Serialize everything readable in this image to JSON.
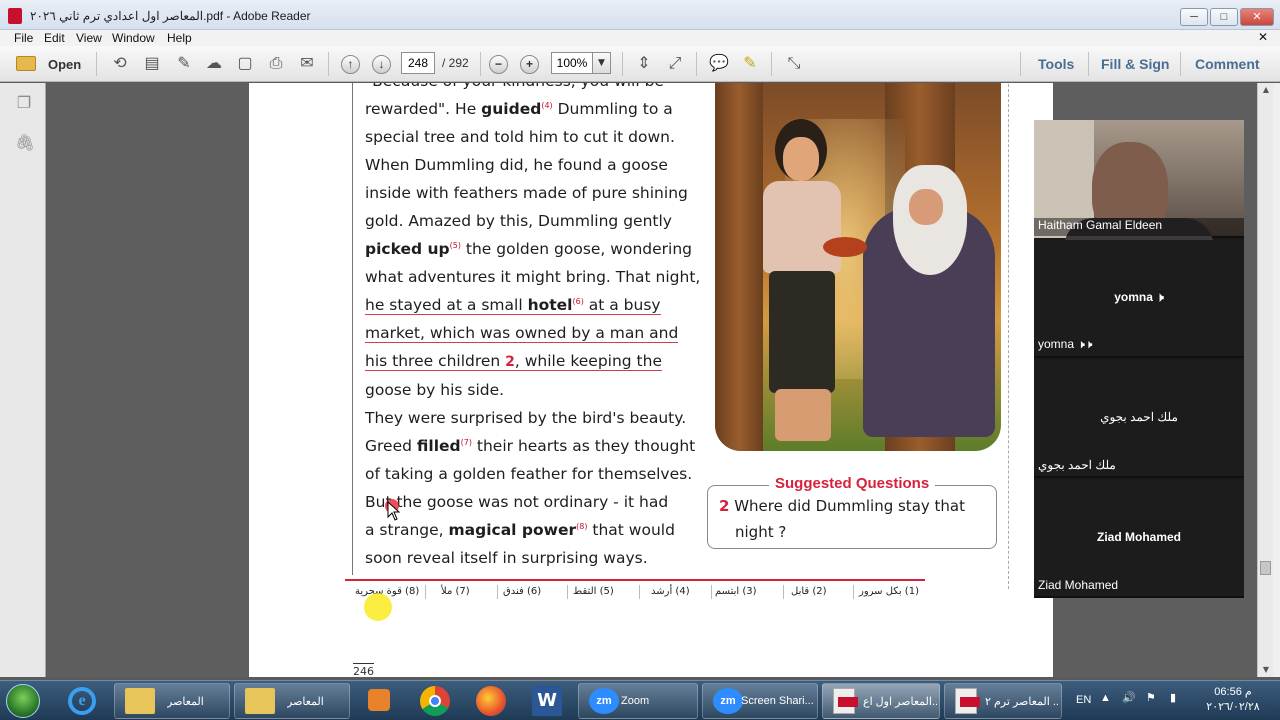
{
  "window": {
    "title": "المعاصر اول اعدادي ترم ثاني ٢٠٢٦.pdf - Adobe Reader",
    "minimize": "─",
    "maximize": "□",
    "close": "✕"
  },
  "menu": {
    "items": [
      "File",
      "Edit",
      "View",
      "Window",
      "Help"
    ],
    "doc_close": "✕"
  },
  "toolbar": {
    "open_label": "Open",
    "page_current": "248",
    "page_total": "/ 292",
    "zoom": "100%",
    "right_tools": [
      "Tools",
      "Fill & Sign",
      "Comment"
    ]
  },
  "story": {
    "lines": [
      {
        "parts": [
          {
            "t": "\"Because of your kindness, you will be"
          }
        ]
      },
      {
        "parts": [
          {
            "t": "rewarded\". He "
          },
          {
            "t": "guided",
            "b": true
          },
          {
            "t": "(4)",
            "sup": true
          },
          {
            "t": " Dummling to a"
          }
        ]
      },
      {
        "parts": [
          {
            "t": "special tree and told him to cut it down."
          }
        ]
      },
      {
        "parts": [
          {
            "t": "When Dummling did, he found a goose"
          }
        ]
      },
      {
        "parts": [
          {
            "t": "inside with feathers made of pure shining"
          }
        ]
      },
      {
        "parts": [
          {
            "t": "gold. Amazed by this, Dummling gently"
          }
        ]
      },
      {
        "parts": [
          {
            "t": "picked up",
            "b": true
          },
          {
            "t": "(5)",
            "sup": true
          },
          {
            "t": " the golden goose, wondering"
          }
        ]
      },
      {
        "parts": [
          {
            "t": "what adventures it might bring. That night,"
          }
        ]
      },
      {
        "hl": true,
        "parts": [
          {
            "t": "he stayed at a small "
          },
          {
            "t": "hotel",
            "b": true
          },
          {
            "t": "(6)",
            "sup": true
          },
          {
            "t": " at a busy"
          }
        ]
      },
      {
        "hl": true,
        "parts": [
          {
            "t": "market, which was owned by a man and"
          }
        ]
      },
      {
        "hl": true,
        "parts": [
          {
            "t": "his three children"
          },
          {
            "t": " 2",
            "q": true
          },
          {
            "t": ", while keeping the"
          }
        ]
      },
      {
        "parts": [
          {
            "t": "goose by his side."
          }
        ]
      },
      {
        "parts": [
          {
            "t": "They were surprised by the bird's beauty."
          }
        ]
      },
      {
        "parts": [
          {
            "t": "Greed "
          },
          {
            "t": "filled",
            "b": true
          },
          {
            "t": "(7)",
            "sup": true
          },
          {
            "t": " their hearts as they thought"
          }
        ]
      },
      {
        "parts": [
          {
            "t": "of taking a golden feather for themselves."
          }
        ]
      },
      {
        "parts": [
          {
            "t": "But the goose was not ordinary - it had"
          }
        ]
      },
      {
        "parts": [
          {
            "t": "a strange, "
          },
          {
            "t": "magical power",
            "b": true
          },
          {
            "t": "(8)",
            "sup": true
          },
          {
            "t": " that would"
          }
        ]
      },
      {
        "parts": [
          {
            "t": "soon reveal itself in surprising ways."
          }
        ]
      }
    ]
  },
  "suggested_questions": {
    "title": "Suggested Questions",
    "number": "2",
    "question_line1": " Where did Dummling stay that",
    "question_line2": "night ?"
  },
  "glossary": [
    "(1) بكل سرور",
    "(2) قابل",
    "(3) ابتسم",
    "(4) أرشد",
    "(5) التقط",
    "(6) فندق",
    "(7) ملأ",
    "(8) قوة سحرية"
  ],
  "page_number_printed": "246",
  "zoom_participants": [
    {
      "name": "Haitham Gamal Eldeen",
      "video": true
    },
    {
      "name": "yomna",
      "center": "yomna 🕨",
      "corner": "yomna 🕨🕨"
    },
    {
      "center": "ملك احمد بجوي",
      "corner": "ملك احمد بجوي"
    },
    {
      "center": "Ziad Mohamed",
      "corner": "Ziad Mohamed"
    }
  ],
  "taskbar": {
    "buttons": [
      {
        "label": "المعاصر",
        "icon": "folder-icon"
      },
      {
        "label": "المعاصر",
        "icon": "folder-icon"
      },
      {
        "label": "Zoom",
        "icon": "zoom-icon"
      },
      {
        "label": "Screen Shari...",
        "icon": "zoom-icon"
      },
      {
        "label": "المعاصر اول اع...",
        "icon": "pdf-icon"
      },
      {
        "label": "المعاصر ترم ٢ ...",
        "icon": "pdf-icon"
      }
    ],
    "language": "EN",
    "time": "06:56 م",
    "date": "٢٠٢٦/٠٢/٢٨"
  }
}
